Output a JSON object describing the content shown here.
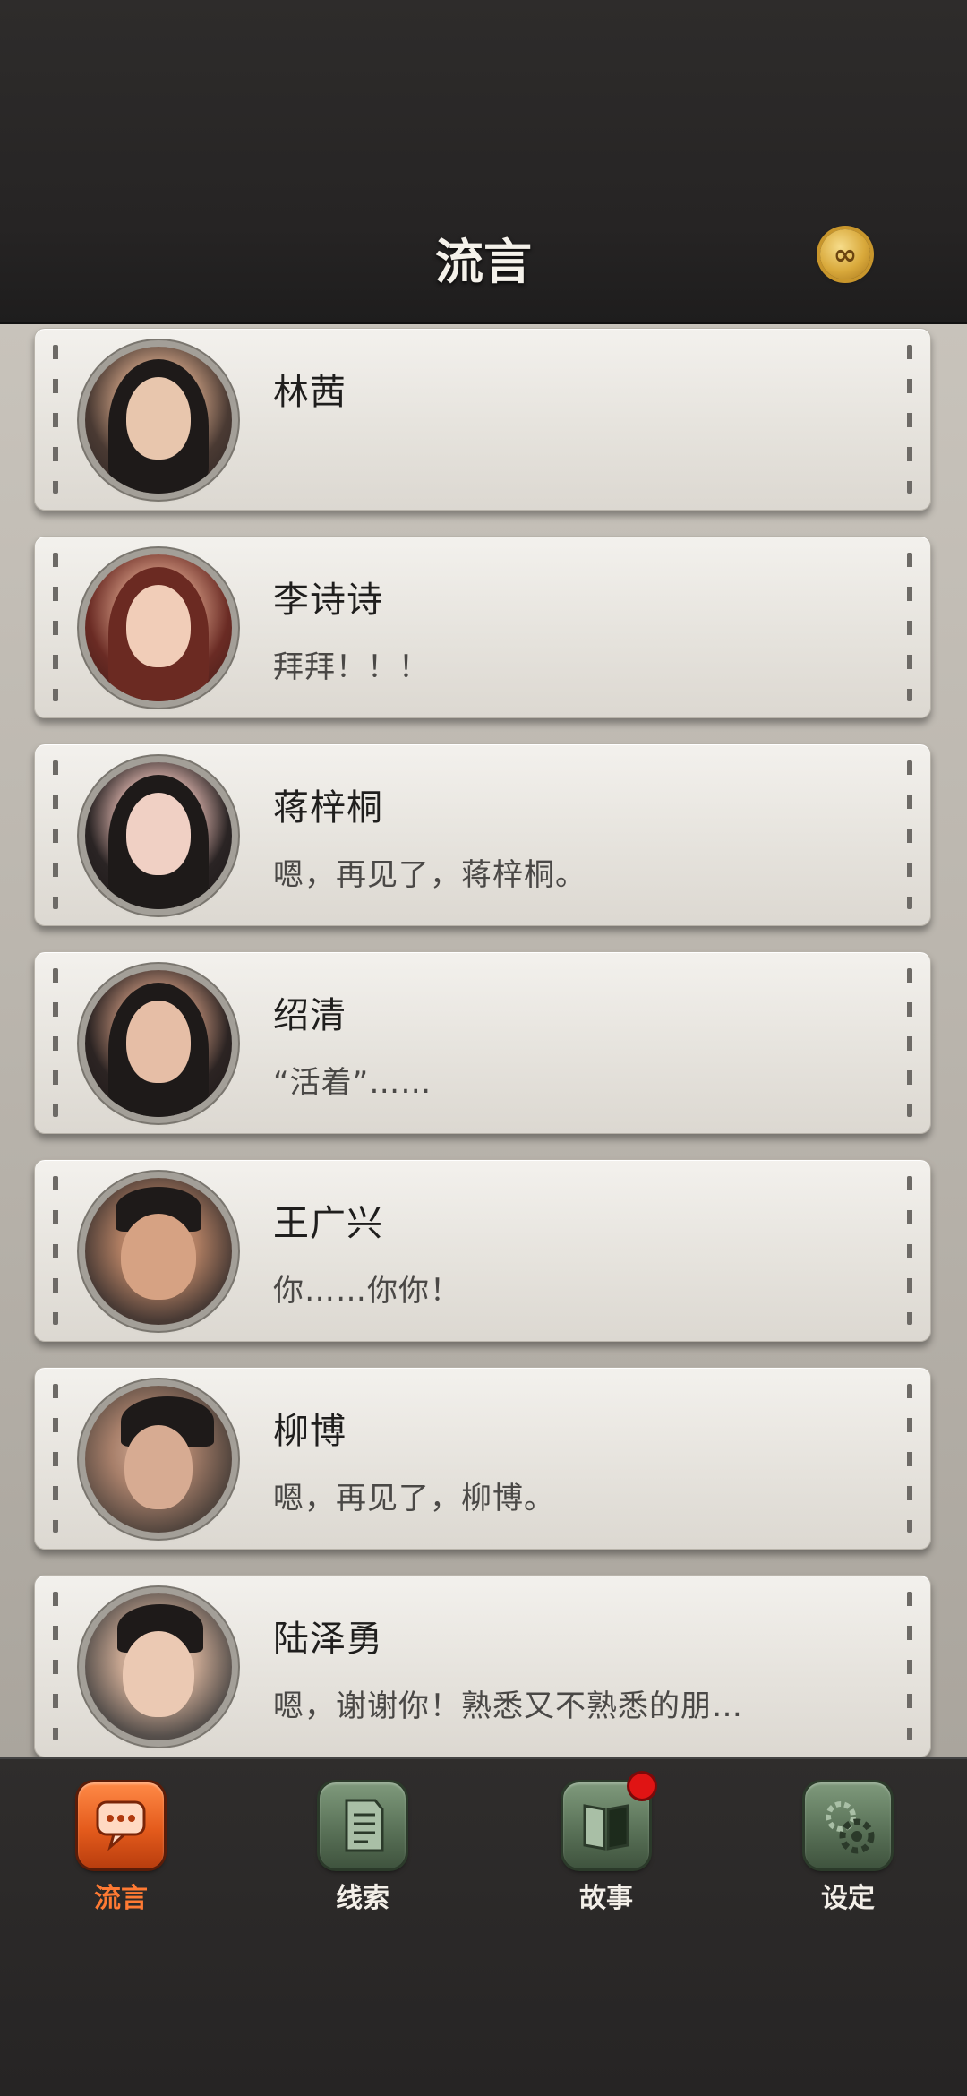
{
  "header": {
    "title": "流言",
    "coin_icon": "infinity-coin-icon",
    "coin_symbol": "∞"
  },
  "contacts": [
    {
      "name": "林茜",
      "message": ""
    },
    {
      "name": "李诗诗",
      "message": "拜拜！！！"
    },
    {
      "name": "蒋梓桐",
      "message": "嗯，再见了，蒋梓桐。"
    },
    {
      "name": "绍清",
      "message": "“活着”……"
    },
    {
      "name": "王广兴",
      "message": "你……你你！"
    },
    {
      "name": "柳博",
      "message": "嗯，再见了，柳博。"
    },
    {
      "name": "陆泽勇",
      "message": "嗯，谢谢你！熟悉又不熟悉的朋…"
    }
  ],
  "nav": {
    "items": [
      {
        "label": "流言",
        "icon": "chat-bubble-icon",
        "active": true
      },
      {
        "label": "线索",
        "icon": "document-icon",
        "active": false
      },
      {
        "label": "故事",
        "icon": "book-icon",
        "active": false,
        "badge": true
      },
      {
        "label": "设定",
        "icon": "gear-icon",
        "active": false
      }
    ]
  },
  "colors": {
    "accent": "#ff7a33",
    "nav_green": "#5a7258",
    "badge_red": "#e01414"
  }
}
